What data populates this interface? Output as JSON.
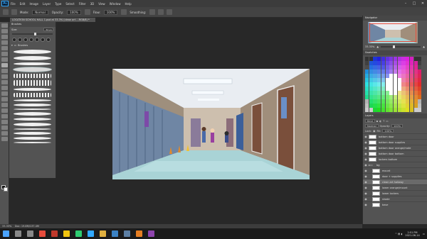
{
  "app": {
    "logo": "Ps"
  },
  "menu": [
    "File",
    "Edit",
    "Image",
    "Layer",
    "Type",
    "Select",
    "Filter",
    "3D",
    "View",
    "Window",
    "Help"
  ],
  "options_bar": {
    "mode_label": "Mode:",
    "mode": "Normal",
    "opacity_label": "Opacity:",
    "opacity": "100%",
    "flow_label": "Flow:",
    "flow": "100%",
    "smoothing_label": "Smoothing:"
  },
  "document_tab": "LOCATION SCHOOL HALL 1.psd at 33.3% (clean art ...RGB/8) *",
  "brushes_panel": {
    "tab": "Brushes",
    "size_label": "Size:",
    "size_value": "60 px",
    "group_label": "Brushes"
  },
  "navigator": {
    "tab": "Navigator",
    "zoom": "33.33%"
  },
  "swatches": {
    "tab": "Swatches"
  },
  "layers": {
    "tab": "Layers",
    "kind": "Kind",
    "blend": "Normal",
    "opacity_label": "Opacity:",
    "opacity": "100%",
    "lock_label": "Lock:",
    "fill_label": "Fill:",
    "fill": "100%",
    "items": [
      {
        "name": "bottom door",
        "type": "layer",
        "indent": false
      },
      {
        "name": "bottom door supplies",
        "type": "layer",
        "indent": false
      },
      {
        "name": "bottom door orange/mote",
        "type": "layer",
        "indent": false
      },
      {
        "name": "bottom door bottom",
        "type": "layer",
        "indent": false
      },
      {
        "name": "lockers bottom",
        "type": "layer",
        "indent": false
      },
      {
        "name": "bg",
        "type": "folder",
        "indent": false
      },
      {
        "name": "mount",
        "type": "layer",
        "indent": true
      },
      {
        "name": "door + supplies",
        "type": "layer",
        "indent": true
      },
      {
        "name": "clean art hallway",
        "type": "layer",
        "indent": true,
        "selected": true
      },
      {
        "name": "lower orange/mount",
        "type": "layer",
        "indent": true
      },
      {
        "name": "lower lockers",
        "type": "layer",
        "indent": true
      },
      {
        "name": "shade",
        "type": "layer",
        "indent": true
      },
      {
        "name": "base",
        "type": "layer",
        "indent": true
      }
    ]
  },
  "status": {
    "zoom": "33.33%",
    "doc": "Doc: 19.8M/137.4M"
  },
  "taskbar": {
    "icons": [
      {
        "name": "start-icon",
        "color": "#4aa3ff"
      },
      {
        "name": "search-taskbar-icon",
        "color": "#888888"
      },
      {
        "name": "taskview-icon",
        "color": "#888888"
      },
      {
        "name": "app-red-icon",
        "color": "#e74c3c"
      },
      {
        "name": "app-red2-icon",
        "color": "#c0392b"
      },
      {
        "name": "explorer-icon",
        "color": "#f1c40f"
      },
      {
        "name": "chrome-icon",
        "color": "#2ecc71"
      },
      {
        "name": "photoshop-taskbar-icon",
        "color": "#31a8ff"
      },
      {
        "name": "folder-taskbar-icon",
        "color": "#e0b040"
      },
      {
        "name": "app-blue-icon",
        "color": "#3b82c4"
      },
      {
        "name": "steam-icon",
        "color": "#5d7fa3"
      },
      {
        "name": "app-orange-icon",
        "color": "#e67e22"
      },
      {
        "name": "app-purple-icon",
        "color": "#8e44ad"
      }
    ],
    "time": "2:51 PM",
    "date": "2021-06-14"
  },
  "colors": {
    "accent": "#31a8ff",
    "panel": "#535353",
    "workspace": "#282828"
  }
}
